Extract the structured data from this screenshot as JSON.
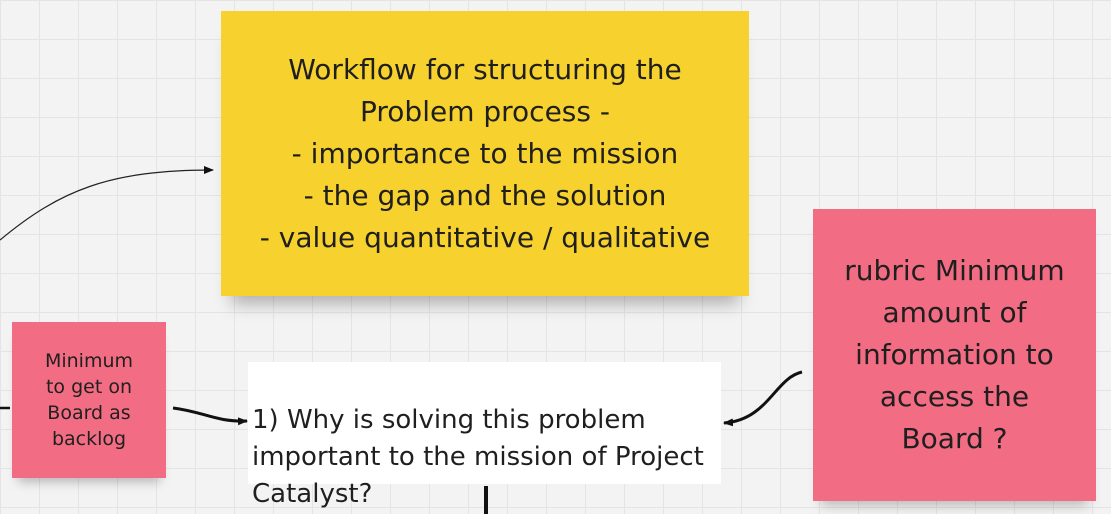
{
  "board": {
    "notes": {
      "workflow": "Workflow for structuring the\nProblem process -\n- importance to the mission\n- the gap and the solution\n- value quantitative / qualitative",
      "minimum_backlog": "Minimum\nto get on\nBoard as\nbacklog",
      "rubric": "rubric Minimum\namount of\ninformation to\naccess the\nBoard ?"
    },
    "question_box": "1) Why is solving this problem\nimportant to the mission of Project\nCatalyst?"
  },
  "colors": {
    "canvas": "#f3f3f3",
    "grid": "#e4e4e4",
    "yellow_note": "#f7d22f",
    "pink_note": "#f26d83",
    "connector": "#111111"
  }
}
